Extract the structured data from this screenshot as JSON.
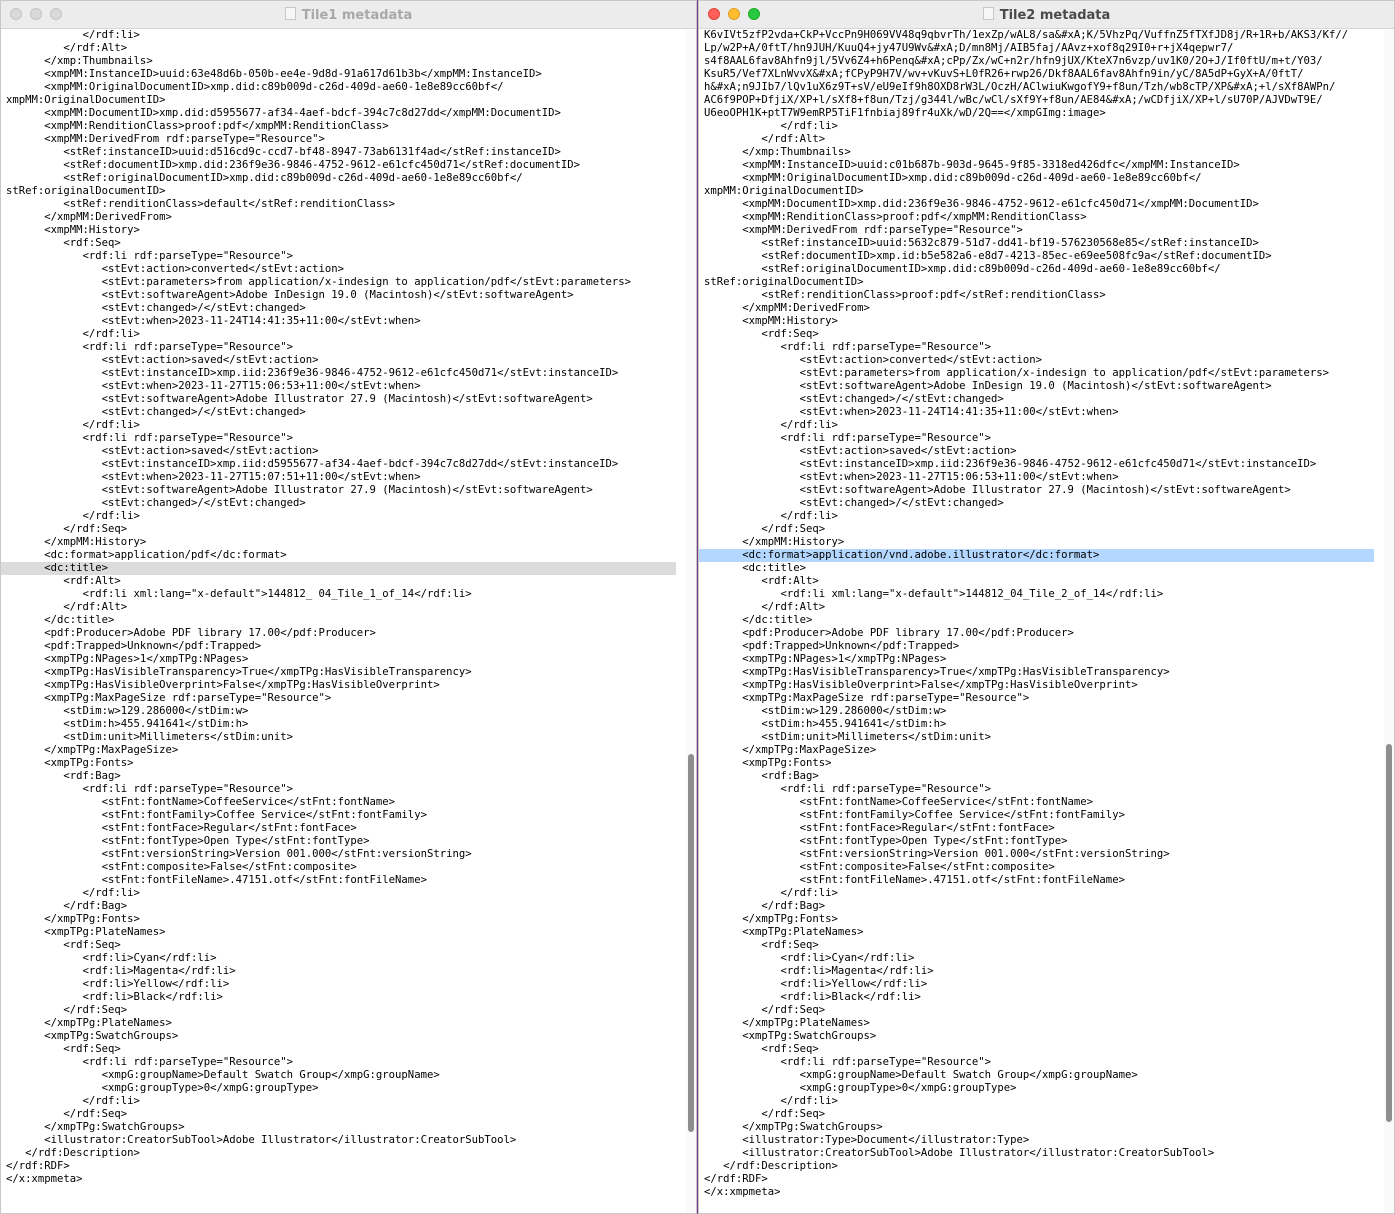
{
  "windows": [
    {
      "id": "w1",
      "title": "Tile1 metadata",
      "active": false,
      "selected_line": 41,
      "selection_color": "#dcdcdc",
      "lines": [
        "            </rdf:li>",
        "         </rdf:Alt>",
        "      </xmp:Thumbnails>",
        "      <xmpMM:InstanceID>uuid:63e48d6b-050b-ee4e-9d8d-91a617d61b3b</xmpMM:InstanceID>",
        "      <xmpMM:OriginalDocumentID>xmp.did:c89b009d-c26d-409d-ae60-1e8e89cc60bf</",
        "xmpMM:OriginalDocumentID>",
        "      <xmpMM:DocumentID>xmp.did:d5955677-af34-4aef-bdcf-394c7c8d27dd</xmpMM:DocumentID>",
        "      <xmpMM:RenditionClass>proof:pdf</xmpMM:RenditionClass>",
        "      <xmpMM:DerivedFrom rdf:parseType=\"Resource\">",
        "         <stRef:instanceID>uuid:d516cd9c-ccd7-bf48-8947-73ab6131f4ad</stRef:instanceID>",
        "         <stRef:documentID>xmp.did:236f9e36-9846-4752-9612-e61cfc450d71</stRef:documentID>",
        "         <stRef:originalDocumentID>xmp.did:c89b009d-c26d-409d-ae60-1e8e89cc60bf</",
        "stRef:originalDocumentID>",
        "         <stRef:renditionClass>default</stRef:renditionClass>",
        "      </xmpMM:DerivedFrom>",
        "      <xmpMM:History>",
        "         <rdf:Seq>",
        "            <rdf:li rdf:parseType=\"Resource\">",
        "               <stEvt:action>converted</stEvt:action>",
        "               <stEvt:parameters>from application/x-indesign to application/pdf</stEvt:parameters>",
        "               <stEvt:softwareAgent>Adobe InDesign 19.0 (Macintosh)</stEvt:softwareAgent>",
        "               <stEvt:changed>/</stEvt:changed>",
        "               <stEvt:when>2023-11-24T14:41:35+11:00</stEvt:when>",
        "            </rdf:li>",
        "            <rdf:li rdf:parseType=\"Resource\">",
        "               <stEvt:action>saved</stEvt:action>",
        "               <stEvt:instanceID>xmp.iid:236f9e36-9846-4752-9612-e61cfc450d71</stEvt:instanceID>",
        "               <stEvt:when>2023-11-27T15:06:53+11:00</stEvt:when>",
        "               <stEvt:softwareAgent>Adobe Illustrator 27.9 (Macintosh)</stEvt:softwareAgent>",
        "               <stEvt:changed>/</stEvt:changed>",
        "            </rdf:li>",
        "            <rdf:li rdf:parseType=\"Resource\">",
        "               <stEvt:action>saved</stEvt:action>",
        "               <stEvt:instanceID>xmp.iid:d5955677-af34-4aef-bdcf-394c7c8d27dd</stEvt:instanceID>",
        "               <stEvt:when>2023-11-27T15:07:51+11:00</stEvt:when>",
        "               <stEvt:softwareAgent>Adobe Illustrator 27.9 (Macintosh)</stEvt:softwareAgent>",
        "               <stEvt:changed>/</stEvt:changed>",
        "            </rdf:li>",
        "         </rdf:Seq>",
        "      </xmpMM:History>",
        "      <dc:format>application/pdf</dc:format>",
        "      <dc:title>",
        "         <rdf:Alt>",
        "            <rdf:li xml:lang=\"x-default\">144812_ 04_Tile_1_of_14</rdf:li>",
        "         </rdf:Alt>",
        "      </dc:title>",
        "      <pdf:Producer>Adobe PDF library 17.00</pdf:Producer>",
        "      <pdf:Trapped>Unknown</pdf:Trapped>",
        "      <xmpTPg:NPages>1</xmpTPg:NPages>",
        "      <xmpTPg:HasVisibleTransparency>True</xmpTPg:HasVisibleTransparency>",
        "      <xmpTPg:HasVisibleOverprint>False</xmpTPg:HasVisibleOverprint>",
        "      <xmpTPg:MaxPageSize rdf:parseType=\"Resource\">",
        "         <stDim:w>129.286000</stDim:w>",
        "         <stDim:h>455.941641</stDim:h>",
        "         <stDim:unit>Millimeters</stDim:unit>",
        "      </xmpTPg:MaxPageSize>",
        "      <xmpTPg:Fonts>",
        "         <rdf:Bag>",
        "            <rdf:li rdf:parseType=\"Resource\">",
        "               <stFnt:fontName>CoffeeService</stFnt:fontName>",
        "               <stFnt:fontFamily>Coffee Service</stFnt:fontFamily>",
        "               <stFnt:fontFace>Regular</stFnt:fontFace>",
        "               <stFnt:fontType>Open Type</stFnt:fontType>",
        "               <stFnt:versionString>Version 001.000</stFnt:versionString>",
        "               <stFnt:composite>False</stFnt:composite>",
        "               <stFnt:fontFileName>.47151.otf</stFnt:fontFileName>",
        "            </rdf:li>",
        "         </rdf:Bag>",
        "      </xmpTPg:Fonts>",
        "      <xmpTPg:PlateNames>",
        "         <rdf:Seq>",
        "            <rdf:li>Cyan</rdf:li>",
        "            <rdf:li>Magenta</rdf:li>",
        "            <rdf:li>Yellow</rdf:li>",
        "            <rdf:li>Black</rdf:li>",
        "         </rdf:Seq>",
        "      </xmpTPg:PlateNames>",
        "      <xmpTPg:SwatchGroups>",
        "         <rdf:Seq>",
        "            <rdf:li rdf:parseType=\"Resource\">",
        "               <xmpG:groupName>Default Swatch Group</xmpG:groupName>",
        "               <xmpG:groupType>0</xmpG:groupType>",
        "            </rdf:li>",
        "         </rdf:Seq>",
        "      </xmpTPg:SwatchGroups>",
        "      <illustrator:CreatorSubTool>Adobe Illustrator</illustrator:CreatorSubTool>",
        "   </rdf:Description>",
        "</rdf:RDF>",
        "</x:xmpmeta>"
      ]
    },
    {
      "id": "w2",
      "title": "Tile2 metadata",
      "active": true,
      "selected_line": 40,
      "selection_color": "#b4d7ff",
      "lines": [
        "K6vIVt5zfP2vda+CkP+VccPn9H069VV48q9qbvrTh/1exZp/wAL8/sa&#xA;K/5VhzPq/VuffnZ5fTXfJD8j/R+1R+b/AKS3/Kf//",
        "Lp/w2P+A/0ftT/hn9JUH/KuuQ4+jy47U9Wv&#xA;D/mn8Mj/AIB5faj/AAvz+xof8q29I0+r+jX4qepwr7/",
        "s4f8AAL6fav8Ahfn9jl/5Vv6Z4+h6Penq&#xA;cPp/Zx/wC+n2r/hfn9jUX/KteX7n6vzp/uv1K0/2O+J/If0ftU/m+t/Y03/",
        "KsuR5/Vef7XLnWvvX&#xA;fCPyP9H7V/wv+vKuvS+L0fR26+rwp26/Dkf8AAL6fav8Ahfn9in/yC/8A5dP+GyX+A/0ftT/",
        "h&#xA;n9JIb7/lQv1uX6z9T+sV/eU9eIf9h8OXD8rW3L/OczH/AClwiuKwgofY9+f8un/Tzh/wb8cTP/XP&#xA;+l/sXf8AWPn/",
        "AC6f9POP+DfjiX/XP+l/sXf8+f8un/Tzj/g344l/wBc/wCl/sXf9Y+f8un/AE84&#xA;/wCDfjiX/XP+l/sU70P/AJVDwT9E/",
        "U6eoOPH1K+ptT7W9emRP5TiF1fnbiaj89fr4uXk/wD/2Q==</xmpGImg:image>",
        "            </rdf:li>",
        "         </rdf:Alt>",
        "      </xmp:Thumbnails>",
        "      <xmpMM:InstanceID>uuid:c01b687b-903d-9645-9f85-3318ed426dfc</xmpMM:InstanceID>",
        "      <xmpMM:OriginalDocumentID>xmp.did:c89b009d-c26d-409d-ae60-1e8e89cc60bf</",
        "xmpMM:OriginalDocumentID>",
        "      <xmpMM:DocumentID>xmp.did:236f9e36-9846-4752-9612-e61cfc450d71</xmpMM:DocumentID>",
        "      <xmpMM:RenditionClass>proof:pdf</xmpMM:RenditionClass>",
        "      <xmpMM:DerivedFrom rdf:parseType=\"Resource\">",
        "         <stRef:instanceID>uuid:5632c879-51d7-dd41-bf19-576230568e85</stRef:instanceID>",
        "         <stRef:documentID>xmp.id:b5e582a6-e8d7-4213-85ec-e69ee508fc9a</stRef:documentID>",
        "         <stRef:originalDocumentID>xmp.did:c89b009d-c26d-409d-ae60-1e8e89cc60bf</",
        "stRef:originalDocumentID>",
        "         <stRef:renditionClass>proof:pdf</stRef:renditionClass>",
        "      </xmpMM:DerivedFrom>",
        "      <xmpMM:History>",
        "         <rdf:Seq>",
        "            <rdf:li rdf:parseType=\"Resource\">",
        "               <stEvt:action>converted</stEvt:action>",
        "               <stEvt:parameters>from application/x-indesign to application/pdf</stEvt:parameters>",
        "               <stEvt:softwareAgent>Adobe InDesign 19.0 (Macintosh)</stEvt:softwareAgent>",
        "               <stEvt:changed>/</stEvt:changed>",
        "               <stEvt:when>2023-11-24T14:41:35+11:00</stEvt:when>",
        "            </rdf:li>",
        "            <rdf:li rdf:parseType=\"Resource\">",
        "               <stEvt:action>saved</stEvt:action>",
        "               <stEvt:instanceID>xmp.iid:236f9e36-9846-4752-9612-e61cfc450d71</stEvt:instanceID>",
        "               <stEvt:when>2023-11-27T15:06:53+11:00</stEvt:when>",
        "               <stEvt:softwareAgent>Adobe Illustrator 27.9 (Macintosh)</stEvt:softwareAgent>",
        "               <stEvt:changed>/</stEvt:changed>",
        "            </rdf:li>",
        "         </rdf:Seq>",
        "      </xmpMM:History>",
        "      <dc:format>application/vnd.adobe.illustrator</dc:format>",
        "      <dc:title>",
        "         <rdf:Alt>",
        "            <rdf:li xml:lang=\"x-default\">144812_04_Tile_2_of_14</rdf:li>",
        "         </rdf:Alt>",
        "      </dc:title>",
        "      <pdf:Producer>Adobe PDF library 17.00</pdf:Producer>",
        "      <pdf:Trapped>Unknown</pdf:Trapped>",
        "      <xmpTPg:NPages>1</xmpTPg:NPages>",
        "      <xmpTPg:HasVisibleTransparency>True</xmpTPg:HasVisibleTransparency>",
        "      <xmpTPg:HasVisibleOverprint>False</xmpTPg:HasVisibleOverprint>",
        "      <xmpTPg:MaxPageSize rdf:parseType=\"Resource\">",
        "         <stDim:w>129.286000</stDim:w>",
        "         <stDim:h>455.941641</stDim:h>",
        "         <stDim:unit>Millimeters</stDim:unit>",
        "      </xmpTPg:MaxPageSize>",
        "      <xmpTPg:Fonts>",
        "         <rdf:Bag>",
        "            <rdf:li rdf:parseType=\"Resource\">",
        "               <stFnt:fontName>CoffeeService</stFnt:fontName>",
        "               <stFnt:fontFamily>Coffee Service</stFnt:fontFamily>",
        "               <stFnt:fontFace>Regular</stFnt:fontFace>",
        "               <stFnt:fontType>Open Type</stFnt:fontType>",
        "               <stFnt:versionString>Version 001.000</stFnt:versionString>",
        "               <stFnt:composite>False</stFnt:composite>",
        "               <stFnt:fontFileName>.47151.otf</stFnt:fontFileName>",
        "            </rdf:li>",
        "         </rdf:Bag>",
        "      </xmpTPg:Fonts>",
        "      <xmpTPg:PlateNames>",
        "         <rdf:Seq>",
        "            <rdf:li>Cyan</rdf:li>",
        "            <rdf:li>Magenta</rdf:li>",
        "            <rdf:li>Yellow</rdf:li>",
        "            <rdf:li>Black</rdf:li>",
        "         </rdf:Seq>",
        "      </xmpTPg:PlateNames>",
        "      <xmpTPg:SwatchGroups>",
        "         <rdf:Seq>",
        "            <rdf:li rdf:parseType=\"Resource\">",
        "               <xmpG:groupName>Default Swatch Group</xmpG:groupName>",
        "               <xmpG:groupType>0</xmpG:groupType>",
        "            </rdf:li>",
        "         </rdf:Seq>",
        "      </xmpTPg:SwatchGroups>",
        "      <illustrator:Type>Document</illustrator:Type>",
        "      <illustrator:CreatorSubTool>Adobe Illustrator</illustrator:CreatorSubTool>",
        "   </rdf:Description>",
        "</rdf:RDF>",
        "</x:xmpmeta>"
      ]
    }
  ]
}
